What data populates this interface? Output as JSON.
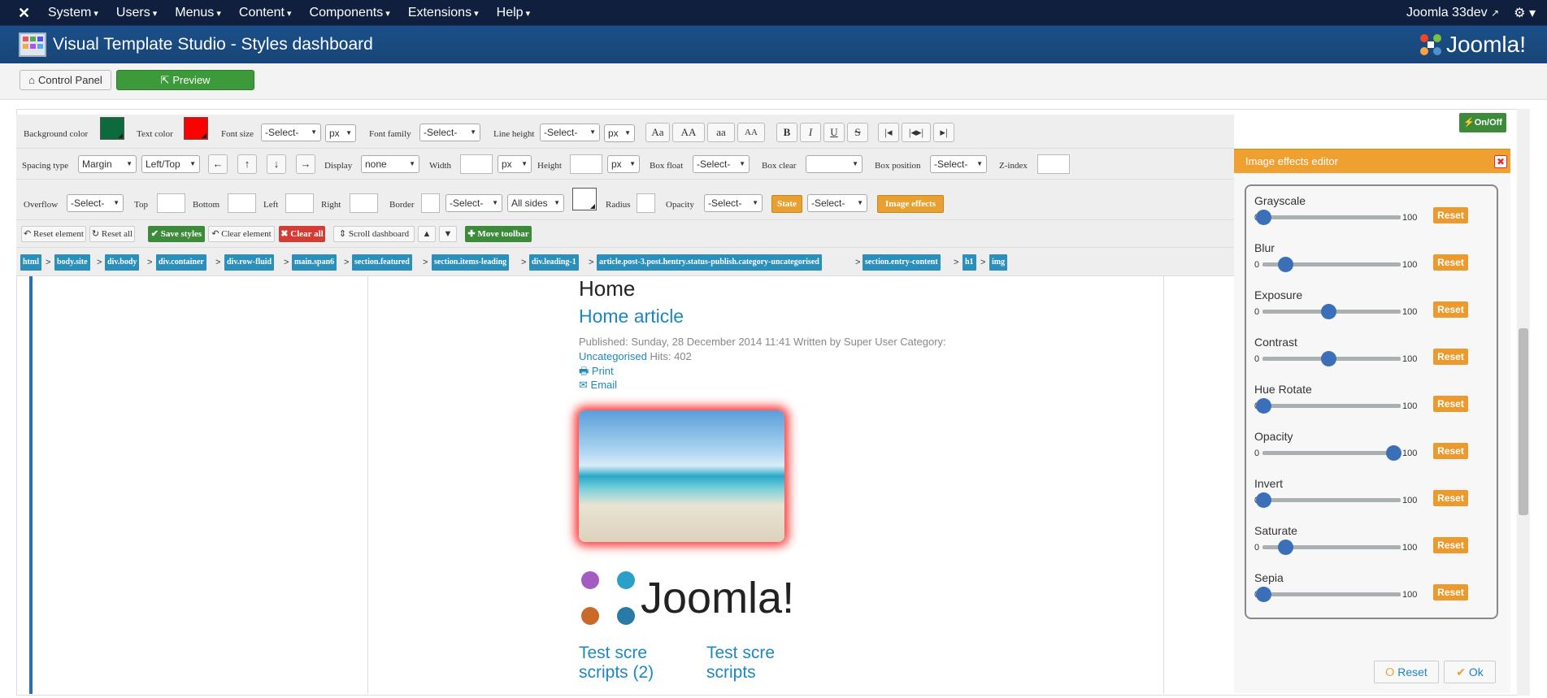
{
  "topnav": {
    "menu": [
      "System",
      "Users",
      "Menus",
      "Content",
      "Components",
      "Extensions",
      "Help"
    ],
    "site": "Joomla 33dev"
  },
  "header": {
    "title": "Visual Template Studio - Styles dashboard",
    "logo": "Joomla!"
  },
  "subbar": {
    "control_panel": "Control Panel",
    "preview": "Preview"
  },
  "toolbar1": {
    "bg_color": "Background color",
    "bg_color_value": "#0b6b3d",
    "text_color": "Text color",
    "text_color_value": "#ff0000",
    "font_size": "Font size",
    "select": "-Select-",
    "unit": "px",
    "font_family": "Font family",
    "line_height": "Line height",
    "case": [
      "Aa",
      "AA",
      "aa",
      "AA"
    ],
    "format": [
      "B",
      "I",
      "U",
      "S"
    ],
    "onoff": "On/Off"
  },
  "toolbar2": {
    "spacing_type": "Spacing type",
    "spacing_value": "Margin",
    "side_value": "Left/Top",
    "display": "Display",
    "display_value": "none",
    "width": "Width",
    "height": "Height",
    "box_float": "Box float",
    "box_clear": "Box clear",
    "box_position": "Box position",
    "z_index": "Z-index"
  },
  "toolbar3": {
    "overflow": "Overflow",
    "top": "Top",
    "bottom": "Bottom",
    "left": "Left",
    "right": "Right",
    "border": "Border",
    "all_sides": "All sides",
    "radius": "Radius",
    "opacity": "Opacity",
    "state": "State",
    "image_effects": "Image effects"
  },
  "toolbar4": {
    "reset_element": "Reset element",
    "reset_all": "Reset all",
    "save_styles": "Save styles",
    "clear_element": "Clear element",
    "clear_all": "Clear all",
    "scroll_dashboard": "Scroll dashboard",
    "move_toolbar": "Move toolbar"
  },
  "breadcrumb": [
    "html",
    "body.site",
    "div.body",
    "div.container",
    "div.row-fluid",
    "main.span6",
    "section.featured",
    "section.items-leading",
    "div.leading-1",
    "article.post-3.post.hentry.status-publish.category-uncategorised",
    "section.entry-content",
    "h1",
    "img"
  ],
  "article": {
    "heading": "Home",
    "title": "Home article",
    "meta1": "Published: Sunday, 28 December 2014 11:41 Written by Super User Category:",
    "category": "Uncategorised",
    "hits": "Hits: 402",
    "print": "Print",
    "email": "Email",
    "logo_text": "Joomla!",
    "link1": "Test scre scripts (2)",
    "link2": "Test scre scripts"
  },
  "panel": {
    "title": "Image effects editor",
    "reset": "Reset",
    "ok": "Ok",
    "effects": [
      {
        "name": "Grayscale",
        "min": "0",
        "max": "100",
        "value": 0
      },
      {
        "name": "Blur",
        "min": "0",
        "max": "100",
        "value": 0.17
      },
      {
        "name": "Exposure",
        "min": "0",
        "max": "100",
        "value": 0.5
      },
      {
        "name": "Contrast",
        "min": "0",
        "max": "100",
        "value": 0.5
      },
      {
        "name": "Hue Rotate",
        "min": "0",
        "max": "100",
        "value": 0
      },
      {
        "name": "Opacity",
        "min": "0",
        "max": "100",
        "value": 1
      },
      {
        "name": "Invert",
        "min": "0",
        "max": "100",
        "value": 0
      },
      {
        "name": "Saturate",
        "min": "0",
        "max": "100",
        "value": 0.17
      },
      {
        "name": "Sepia",
        "min": "0",
        "max": "100",
        "value": 0
      }
    ]
  }
}
